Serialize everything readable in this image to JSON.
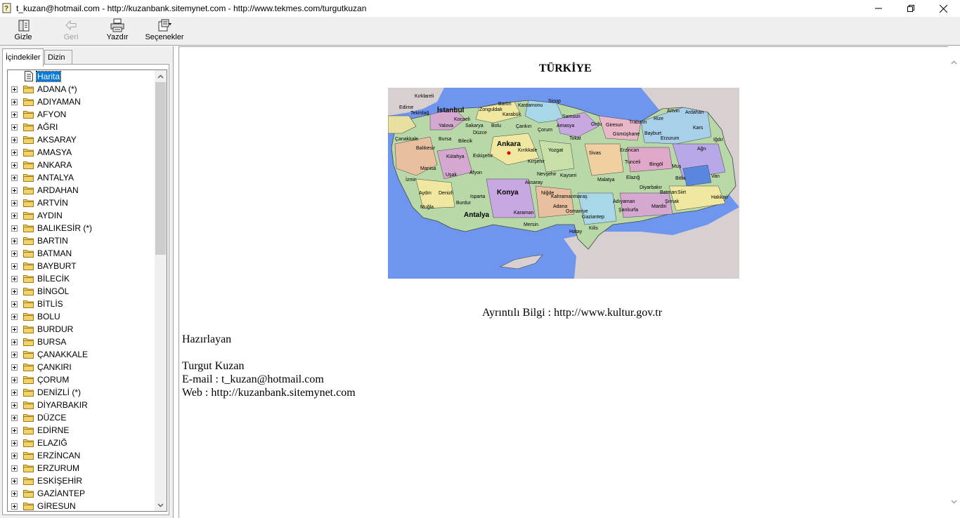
{
  "window": {
    "title": "t_kuzan@hotmail.com - http://kuzanbank.sitemynet.com - http://www.tekmes.com/turgutkuzan"
  },
  "toolbar": {
    "hide_label": "Gizle",
    "back_label": "Geri",
    "print_label": "Yazdır",
    "options_label": "Seçenekler"
  },
  "tabs": {
    "contents_label": "İçindekiler",
    "index_label": "Dizin"
  },
  "tree": {
    "root": "Harita",
    "items": [
      "ADANA (*)",
      "ADIYAMAN",
      "AFYON",
      "AĞRI",
      "AKSARAY",
      "AMASYA",
      "ANKARA",
      "ANTALYA",
      "ARDAHAN",
      "ARTVİN",
      "AYDIN",
      "BALIKESİR (*)",
      "BARTIN",
      "BATMAN",
      "BAYBURT",
      "BİLECİK",
      "BİNGÖL",
      "BİTLİS",
      "BOLU",
      "BURDUR",
      "BURSA",
      "ÇANAKKALE",
      "ÇANKIRI",
      "ÇORUM",
      "DENİZLİ (*)",
      "DİYARBAKIR",
      "DÜZCE",
      "EDİRNE",
      "ELAZIĞ",
      "ERZİNCAN",
      "ERZURUM",
      "ESKİŞEHİR",
      "GAZİANTEP",
      "GİRESUN"
    ]
  },
  "page": {
    "heading": "TÜRKİYE",
    "info": "Ayrıntılı Bilgi : http://www.kultur.gov.tr",
    "prepared_label": "Hazırlayan",
    "author": "Turgut Kuzan",
    "email": "E-mail : t_kuzan@hotmail.com",
    "web": "Web : http://kuzanbank.sitemynet.com"
  },
  "map": {
    "labels": [
      "Kırklareli",
      "Edirne",
      "Tekirdağ",
      "İstanbul",
      "Zonguldak",
      "Bartın",
      "Kastamonu",
      "Sinop",
      "Karabük",
      "Samsun",
      "Kocaeli",
      "Yalova",
      "Sakarya",
      "Bolu",
      "Çankırı",
      "Çorum",
      "Amasya",
      "Ordu",
      "Giresun",
      "Trabzon",
      "Rize",
      "Artvin",
      "Ardahan",
      "Kars",
      "Iğdır",
      "Düzce",
      "Bayburt",
      "Gümüşhane",
      "Erzurum",
      "Çanakkale",
      "Balıkesir",
      "Bursa",
      "Bilecik",
      "Ankara",
      "Kırıkkale",
      "Yozgat",
      "Tokat",
      "Sivas",
      "Erzincan",
      "Ağrı",
      "Kütahya",
      "Eskişehir",
      "Kırşehir",
      "Tunceli",
      "Bingöl",
      "Muş",
      "Manisa",
      "Uşak",
      "Afyon",
      "Nevşehir",
      "Kayseri",
      "Malatya",
      "Elazığ",
      "Bitlis",
      "Van",
      "İzmir",
      "Aydın",
      "Denizli",
      "Isparta",
      "Konya",
      "Aksaray",
      "Niğde",
      "Kahramanmaraş",
      "Adıyaman",
      "Diyarbakır",
      "Batman",
      "Siirt",
      "Hakkari",
      "Şırnak",
      "Muğla",
      "Burdur",
      "Antalya",
      "Karaman",
      "Adana",
      "Osmaniye",
      "Gaziantep",
      "Şanlıurfa",
      "Mardin",
      "Mersin",
      "Hatay",
      "Kilis"
    ],
    "colors": {
      "sea": "#6e96ee",
      "land_neighbor": "#d8d0d0"
    }
  }
}
